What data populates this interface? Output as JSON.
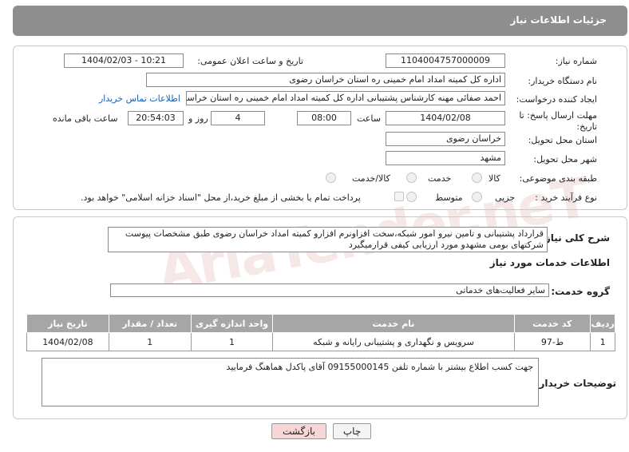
{
  "header": {
    "title": "جزئیات اطلاعات نیاز"
  },
  "fields": {
    "need_number_label": "شماره نیاز:",
    "need_number": "1104004757000009",
    "announce_label": "تاریخ و ساعت اعلان عمومی:",
    "announce_value": "1404/02/03 - 10:21",
    "buyer_org_label": "نام دستگاه خریدار:",
    "buyer_org": "اداره کل کمیته امداد امام خمینی  ره  استان خراسان رضوی",
    "requester_label": "ایجاد کننده درخواست:",
    "requester": "احمد صفائی مهنه کارشناس پشتیبانی اداره کل کمیته امداد امام خمینی  ره  استان خراسان رضوی",
    "contact_link": "اطلاعات تماس خریدار",
    "deadline_label": "مهلت ارسال پاسخ: تا تاریخ:",
    "deadline_date": "1404/02/08",
    "hour_label": "ساعت",
    "deadline_hour": "08:00",
    "days": "4",
    "days_label": "روز و",
    "remaining_time": "20:54:03",
    "remaining_label": "ساعت باقی مانده",
    "province_label": "استان محل تحویل:",
    "province": "خراسان رضوی",
    "city_label": "شهر محل تحویل:",
    "city": "مشهد",
    "category_label": "طبقه بندی موضوعی:",
    "category_options": [
      "کالا",
      "خدمت",
      "کالا/خدمت"
    ],
    "process_label": "نوع فرآیند خرید :",
    "process_options": [
      "جزیی",
      "متوسط"
    ],
    "payment_note": "پرداخت تمام یا بخشی از مبلغ خرید،از محل \"اسناد خزانه اسلامی\" خواهد بود."
  },
  "description": {
    "label": "شرح کلی نیاز:",
    "text": "قرارداد پشتیبانی و تامین نیرو امور شبکه،سخت افزاونرم افزارو کمیته امداد خراسان رضوی طبق مشخصات پیوست شرکتهای بومی مشهدو مورد ارزیابی کیفی قرارمیگیرد"
  },
  "services": {
    "section_title": "اطلاعات خدمات مورد نیاز",
    "group_label": "گروه خدمت:",
    "group_value": "سایر فعالیت‌های خدماتی",
    "columns": [
      "ردیف",
      "کد خدمت",
      "نام خدمت",
      "واحد اندازه گیری",
      "تعداد / مقدار",
      "تاریخ نیاز"
    ],
    "rows": [
      [
        "1",
        "ط-97",
        "سرویس و نگهداری و پشتیبانی رایانه و شبکه",
        "1",
        "1",
        "1404/02/08"
      ]
    ]
  },
  "buyer_notes": {
    "label": "توضیحات خریدار:",
    "text": "جهت کسب اطلاع بیشتر با شماره تلفن 09155000145 آقای پاکدل هماهنگ فرمایید"
  },
  "buttons": {
    "print": "چاپ",
    "back": "بازگشت"
  },
  "watermark": "AriaTender.neT",
  "colors": {
    "header_bg": "#8e8e8e",
    "link": "#1a5fb4",
    "back_btn_bg": "#f6d6d6"
  }
}
